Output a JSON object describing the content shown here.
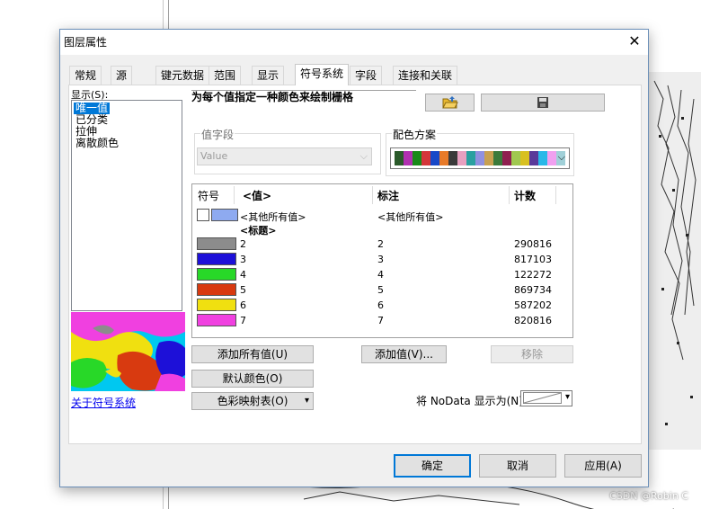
{
  "window": {
    "title": "图层属性",
    "close_glyph": "✕"
  },
  "tabs": [
    {
      "label": "常规",
      "active": false
    },
    {
      "label": "源",
      "active": false
    },
    {
      "label": "键元数据",
      "active": false
    },
    {
      "label": "范围",
      "active": false
    },
    {
      "label": "显示",
      "active": false
    },
    {
      "label": "符号系统",
      "active": true
    },
    {
      "label": "字段",
      "active": false
    },
    {
      "label": "连接和关联",
      "active": false
    }
  ],
  "show": {
    "label": "显示(S):",
    "items": [
      "唯一值",
      "已分类",
      "拉伸",
      "离散颜色"
    ],
    "selected_index": 0
  },
  "renderer": {
    "description": "为每个值指定一种颜色来绘制栅格",
    "open_icon": "folder-open-icon",
    "save_icon": "save-icon"
  },
  "value_field": {
    "label": "值字段",
    "value": "Value",
    "dropdown_glyph": "⌵"
  },
  "color_scheme": {
    "label": "配色方案",
    "dropdown_glyph": "⌵",
    "colors": [
      "#2a5a2a",
      "#b030b0",
      "#1a8a1a",
      "#d4363a",
      "#1848c8",
      "#e87a28",
      "#3a3a3a",
      "#e8a0c0",
      "#2aa0a0",
      "#9090e0",
      "#c8a050",
      "#3a7a3a",
      "#902050",
      "#a0c850",
      "#d8c020",
      "#5a3a9a",
      "#28b8e8",
      "#f0a0f0",
      "#a0d0d8"
    ]
  },
  "table": {
    "headers": {
      "symbol": "符号",
      "value": "<值>",
      "label": "标注",
      "count": "计数"
    },
    "other_row": {
      "value": "<其他所有值>",
      "label": "<其他所有值>",
      "color": "#8eaaf0"
    },
    "heading_row": {
      "value": "<标题>"
    },
    "rows": [
      {
        "value": "2",
        "label": "2",
        "count": "290816",
        "color": "#8c8c8c"
      },
      {
        "value": "3",
        "label": "3",
        "count": "817103",
        "color": "#1d10d8"
      },
      {
        "value": "4",
        "label": "4",
        "count": "122272",
        "color": "#28d828"
      },
      {
        "value": "5",
        "label": "5",
        "count": "869734",
        "color": "#d83a10"
      },
      {
        "value": "6",
        "label": "6",
        "count": "587202",
        "color": "#f0e010"
      },
      {
        "value": "7",
        "label": "7",
        "count": "820816",
        "color": "#f040e0"
      }
    ]
  },
  "buttons": {
    "add_all": "添加所有值(U)",
    "add_values": "添加值(V)...",
    "remove": "移除",
    "default_colors": "默认颜色(O)",
    "colormap": "色彩映射表(O)",
    "colormap_glyph": "▾",
    "nodata_label": "将 NoData 显示为(N)",
    "nodata_glyph": "▾",
    "ok": "确定",
    "cancel": "取消",
    "apply": "应用(A)"
  },
  "about_link": "关于符号系统",
  "watermark": "CSDN @Robin C"
}
